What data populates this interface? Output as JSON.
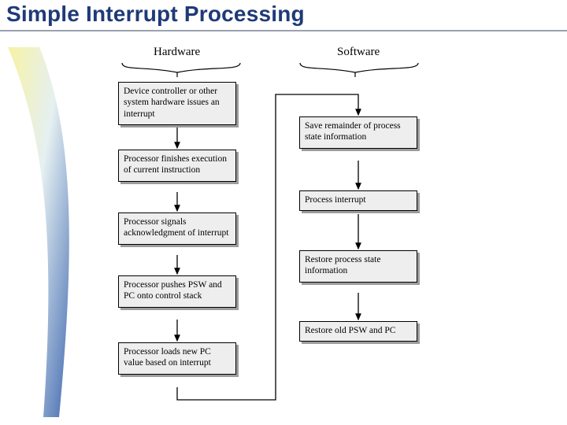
{
  "title": "Simple Interrupt Processing",
  "columns": {
    "hardware": "Hardware",
    "software": "Software"
  },
  "hardware_steps": [
    {
      "text": "Device controller or other system hardware issues an interrupt"
    },
    {
      "text": "Processor finishes execution of current instruction"
    },
    {
      "text": "Processor signals acknowledgment of interrupt"
    },
    {
      "text": "Processor pushes PSW and PC onto control stack"
    },
    {
      "text": "Processor loads new PC value based on interrupt"
    }
  ],
  "software_steps": [
    {
      "text": "Save remainder of process state information"
    },
    {
      "text": "Process interrupt"
    },
    {
      "text": "Restore process state information"
    },
    {
      "text": "Restore old PSW and PC"
    }
  ],
  "chart_data": {
    "type": "flowchart",
    "title": "Simple Interrupt Processing",
    "columns": [
      "Hardware",
      "Software"
    ],
    "nodes": [
      {
        "id": "H1",
        "col": "Hardware",
        "label": "Device controller or other system hardware issues an interrupt"
      },
      {
        "id": "H2",
        "col": "Hardware",
        "label": "Processor finishes execution of current instruction"
      },
      {
        "id": "H3",
        "col": "Hardware",
        "label": "Processor signals acknowledgment of interrupt"
      },
      {
        "id": "H4",
        "col": "Hardware",
        "label": "Processor pushes PSW and PC onto control stack"
      },
      {
        "id": "H5",
        "col": "Hardware",
        "label": "Processor loads new PC value based on interrupt"
      },
      {
        "id": "S1",
        "col": "Software",
        "label": "Save remainder of process state information"
      },
      {
        "id": "S2",
        "col": "Software",
        "label": "Process interrupt"
      },
      {
        "id": "S3",
        "col": "Software",
        "label": "Restore process state information"
      },
      {
        "id": "S4",
        "col": "Software",
        "label": "Restore old PSW and PC"
      }
    ],
    "edges": [
      {
        "from": "H1",
        "to": "H2"
      },
      {
        "from": "H2",
        "to": "H3"
      },
      {
        "from": "H3",
        "to": "H4"
      },
      {
        "from": "H4",
        "to": "H5"
      },
      {
        "from": "H5",
        "to": "S1"
      },
      {
        "from": "S1",
        "to": "S2"
      },
      {
        "from": "S2",
        "to": "S3"
      },
      {
        "from": "S3",
        "to": "S4"
      }
    ]
  }
}
